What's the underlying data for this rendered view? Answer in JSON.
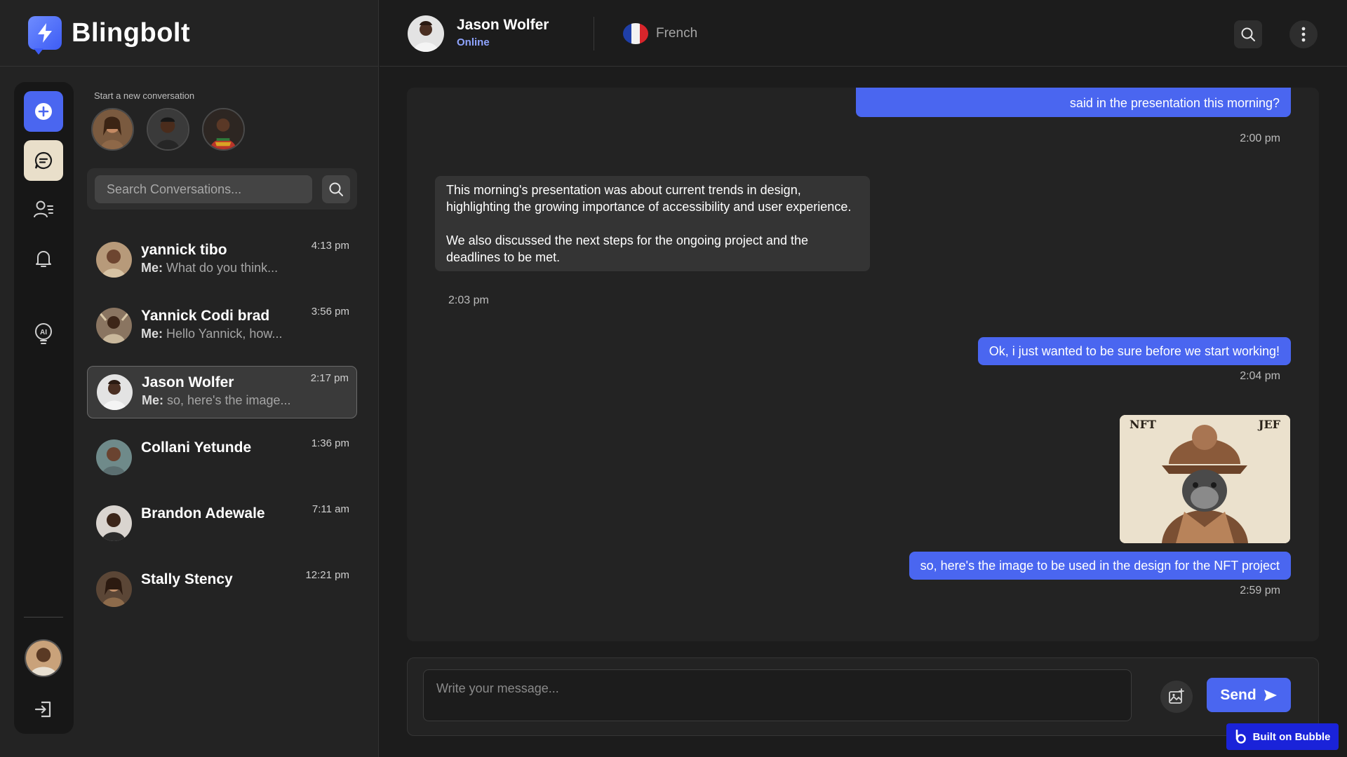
{
  "brand": {
    "name": "Blingbolt",
    "accent": "#4a66f0"
  },
  "sidebar": {
    "new_conversation_label": "Start a new conversation",
    "search_placeholder": "Search Conversations...",
    "rail_icons": [
      "plus-circle-icon",
      "chat-bubble-icon",
      "contacts-icon",
      "bell-icon",
      "ai-bulb-icon",
      "logout-icon"
    ],
    "conversations": [
      {
        "name": "yannick tibo",
        "me": "Me:",
        "preview": "What do you think...",
        "time": "4:13 pm",
        "active": false
      },
      {
        "name": "Yannick Codi brad",
        "me": "Me:",
        "preview": "Hello Yannick, how...",
        "time": "3:56 pm",
        "active": false
      },
      {
        "name": "Jason Wolfer",
        "me": "Me:",
        "preview": "so, here's the image...",
        "time": "2:17 pm",
        "active": true
      },
      {
        "name": "Collani Yetunde",
        "me": "",
        "preview": "",
        "time": "1:36 pm",
        "active": false
      },
      {
        "name": "Brandon Adewale",
        "me": "",
        "preview": "",
        "time": "7:11 am",
        "active": false
      },
      {
        "name": "Stally Stency",
        "me": "",
        "preview": "",
        "time": "12:21 pm",
        "active": false
      }
    ]
  },
  "header": {
    "contact_name": "Jason Wolfer",
    "status": "Online",
    "language": "French"
  },
  "messages": [
    {
      "direction": "out",
      "text": "said in the presentation this morning?",
      "time": "2:00 pm"
    },
    {
      "direction": "in",
      "text": "This morning's presentation was about current trends in design, highlighting the growing importance of accessibility and user experience.\n\nWe also discussed the next steps for the ongoing project and the deadlines to be met.",
      "time": "2:03 pm"
    },
    {
      "direction": "out",
      "text": "Ok, i just wanted to be sure before we start working!",
      "time": "2:04 pm"
    },
    {
      "direction": "out",
      "type": "image",
      "tag_left": "NFT",
      "tag_right": "JEF"
    },
    {
      "direction": "out",
      "text": "so, here's the image to be used in the design for the NFT project",
      "time": "2:59 pm"
    }
  ],
  "composer": {
    "placeholder": "Write your message...",
    "send_label": "Send"
  },
  "badge": {
    "label": "Built on Bubble"
  }
}
